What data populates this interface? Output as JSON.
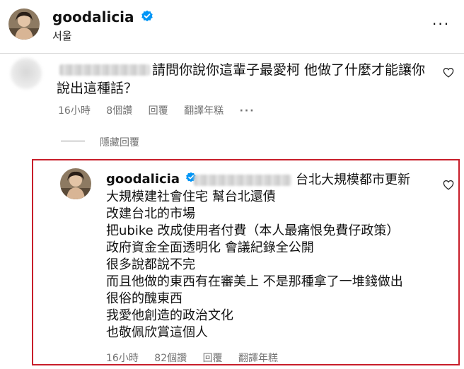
{
  "header": {
    "username": "goodalicia",
    "location": "서울"
  },
  "comment": {
    "text_line1": "請問你說你這輩子最愛柯 他做了什麼才能讓你",
    "text_line2": "說出這種話？",
    "time": "16小時",
    "likes": "8個讚",
    "reply": "回覆",
    "translate": "翻譯年糕",
    "more": "···"
  },
  "hide_replies": "隱藏回覆",
  "reply": {
    "username": "goodalicia",
    "lines": [
      "台北大規模都市更新",
      "大規模建社會住宅 幫台北還債",
      "改建台北的市場",
      "把ubike 改成使用者付費（本人最痛恨免費仔政策）",
      "政府資金全面透明化 會議紀錄全公開",
      "很多說都說不完",
      "而且他做的東西有在審美上 不是那種拿了一堆錢做出",
      "很俗的醜東西",
      "我愛他創造的政治文化",
      "也敬佩欣賞這個人"
    ],
    "time": "16小時",
    "likes": "82個讚",
    "reply": "回覆",
    "translate": "翻譯年糕"
  },
  "colors": {
    "highlight_border": "#c81e2a",
    "verified_blue": "#0095f6",
    "meta_gray": "#737373"
  }
}
